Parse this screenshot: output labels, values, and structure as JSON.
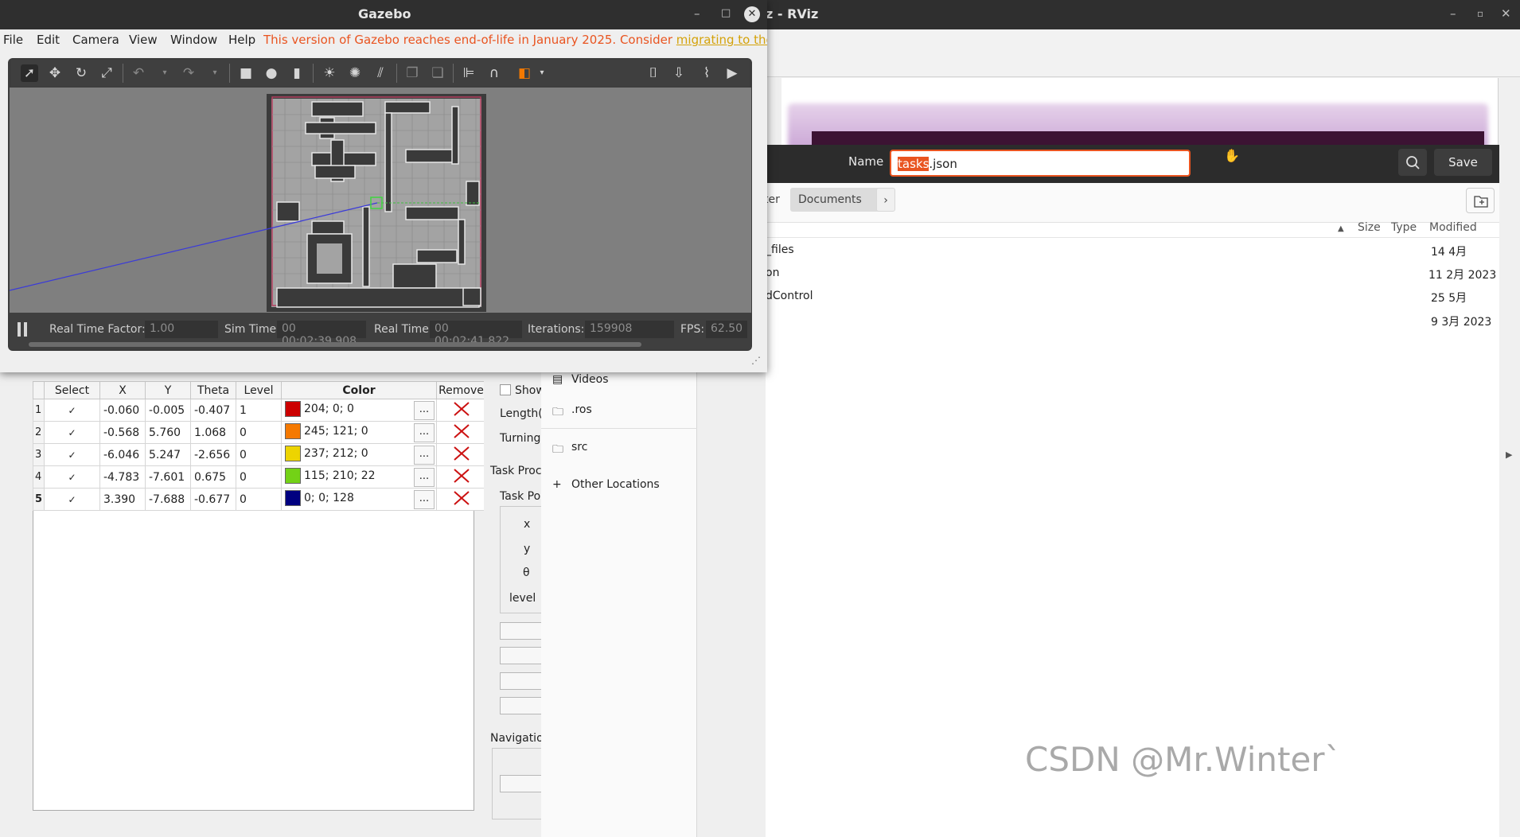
{
  "rviz": {
    "title": "z - RViz",
    "window_buttons": {
      "minimize": "–",
      "maximize": "▫",
      "close": "✕"
    }
  },
  "gazebo": {
    "title": "Gazebo",
    "window_buttons": {
      "minimize": "–",
      "maximize": "□",
      "close": "✕"
    },
    "menu": [
      "File",
      "Edit",
      "Camera",
      "View",
      "Window",
      "Help"
    ],
    "warning_text": "This version of Gazebo reaches end-of-life in January 2025. Consider ",
    "warning_link": "migrating to the new Gaz",
    "status": {
      "real_time_factor_label": "Real Time Factor:",
      "real_time_factor": "1.00",
      "sim_time_label": "Sim Time:",
      "sim_time": "00 00:02:39.908",
      "real_time_label": "Real Time:",
      "real_time": "00 00:02:41.822",
      "iterations_label": "Iterations:",
      "iterations": "159908",
      "fps_label": "FPS:",
      "fps": "62.50"
    }
  },
  "task_table": {
    "headers": [
      "Select",
      "X",
      "Y",
      "Theta",
      "Level",
      "Color",
      "Remove"
    ],
    "rows": [
      {
        "num": "1",
        "x": "-0.060",
        "y": "-0.005",
        "theta": "-0.407",
        "level": "1",
        "color_text": "204; 0; 0",
        "color_hex": "#cc0000"
      },
      {
        "num": "2",
        "x": "-0.568",
        "y": "5.760",
        "theta": "1.068",
        "level": "0",
        "color_text": "245; 121; 0",
        "color_hex": "#f57900"
      },
      {
        "num": "3",
        "x": "-6.046",
        "y": "5.247",
        "theta": "-2.656",
        "level": "0",
        "color_text": "237; 212; 0",
        "color_hex": "#edd400"
      },
      {
        "num": "4",
        "x": "-4.783",
        "y": "-7.601",
        "theta": "0.675",
        "level": "0",
        "color_text": "115; 210; 22",
        "color_hex": "#73d216"
      },
      {
        "num": "5",
        "x": "3.390",
        "y": "-7.688",
        "theta": "-0.677",
        "level": "0",
        "color_text": "0; 0; 128",
        "color_hex": "#000080"
      }
    ],
    "check_mark": "✓",
    "dots_label": "..."
  },
  "mid_panel": {
    "show": "Show",
    "length": "Length(",
    "turning": "Turning",
    "task_proc": "Task Proc",
    "task_pos": "Task Po",
    "x": "x",
    "y": "y",
    "theta": "θ",
    "level": "level",
    "navigation": "Navigatio"
  },
  "file_dialog": {
    "name_label": "Name",
    "name_selected": "tasks",
    "name_rest": ".json",
    "save_label": "Save",
    "breadcrumb_prev": "ter",
    "breadcrumb_current": "Documents",
    "breadcrumb_next": "›",
    "columns": {
      "size": "Size",
      "type": "Type",
      "modified": "Modified"
    },
    "files": [
      {
        "name": "_files",
        "modified": "14 4月"
      },
      {
        "name": "on",
        "modified": "11 2月 2023"
      },
      {
        "name": "dControl",
        "modified": "25 5月"
      },
      {
        "name": "",
        "modified": "9 3月 2023"
      }
    ],
    "sidebar": [
      "Videos",
      ".ros",
      "src",
      "Other Locations"
    ]
  },
  "watermark": "CSDN @Mr.Winter`"
}
